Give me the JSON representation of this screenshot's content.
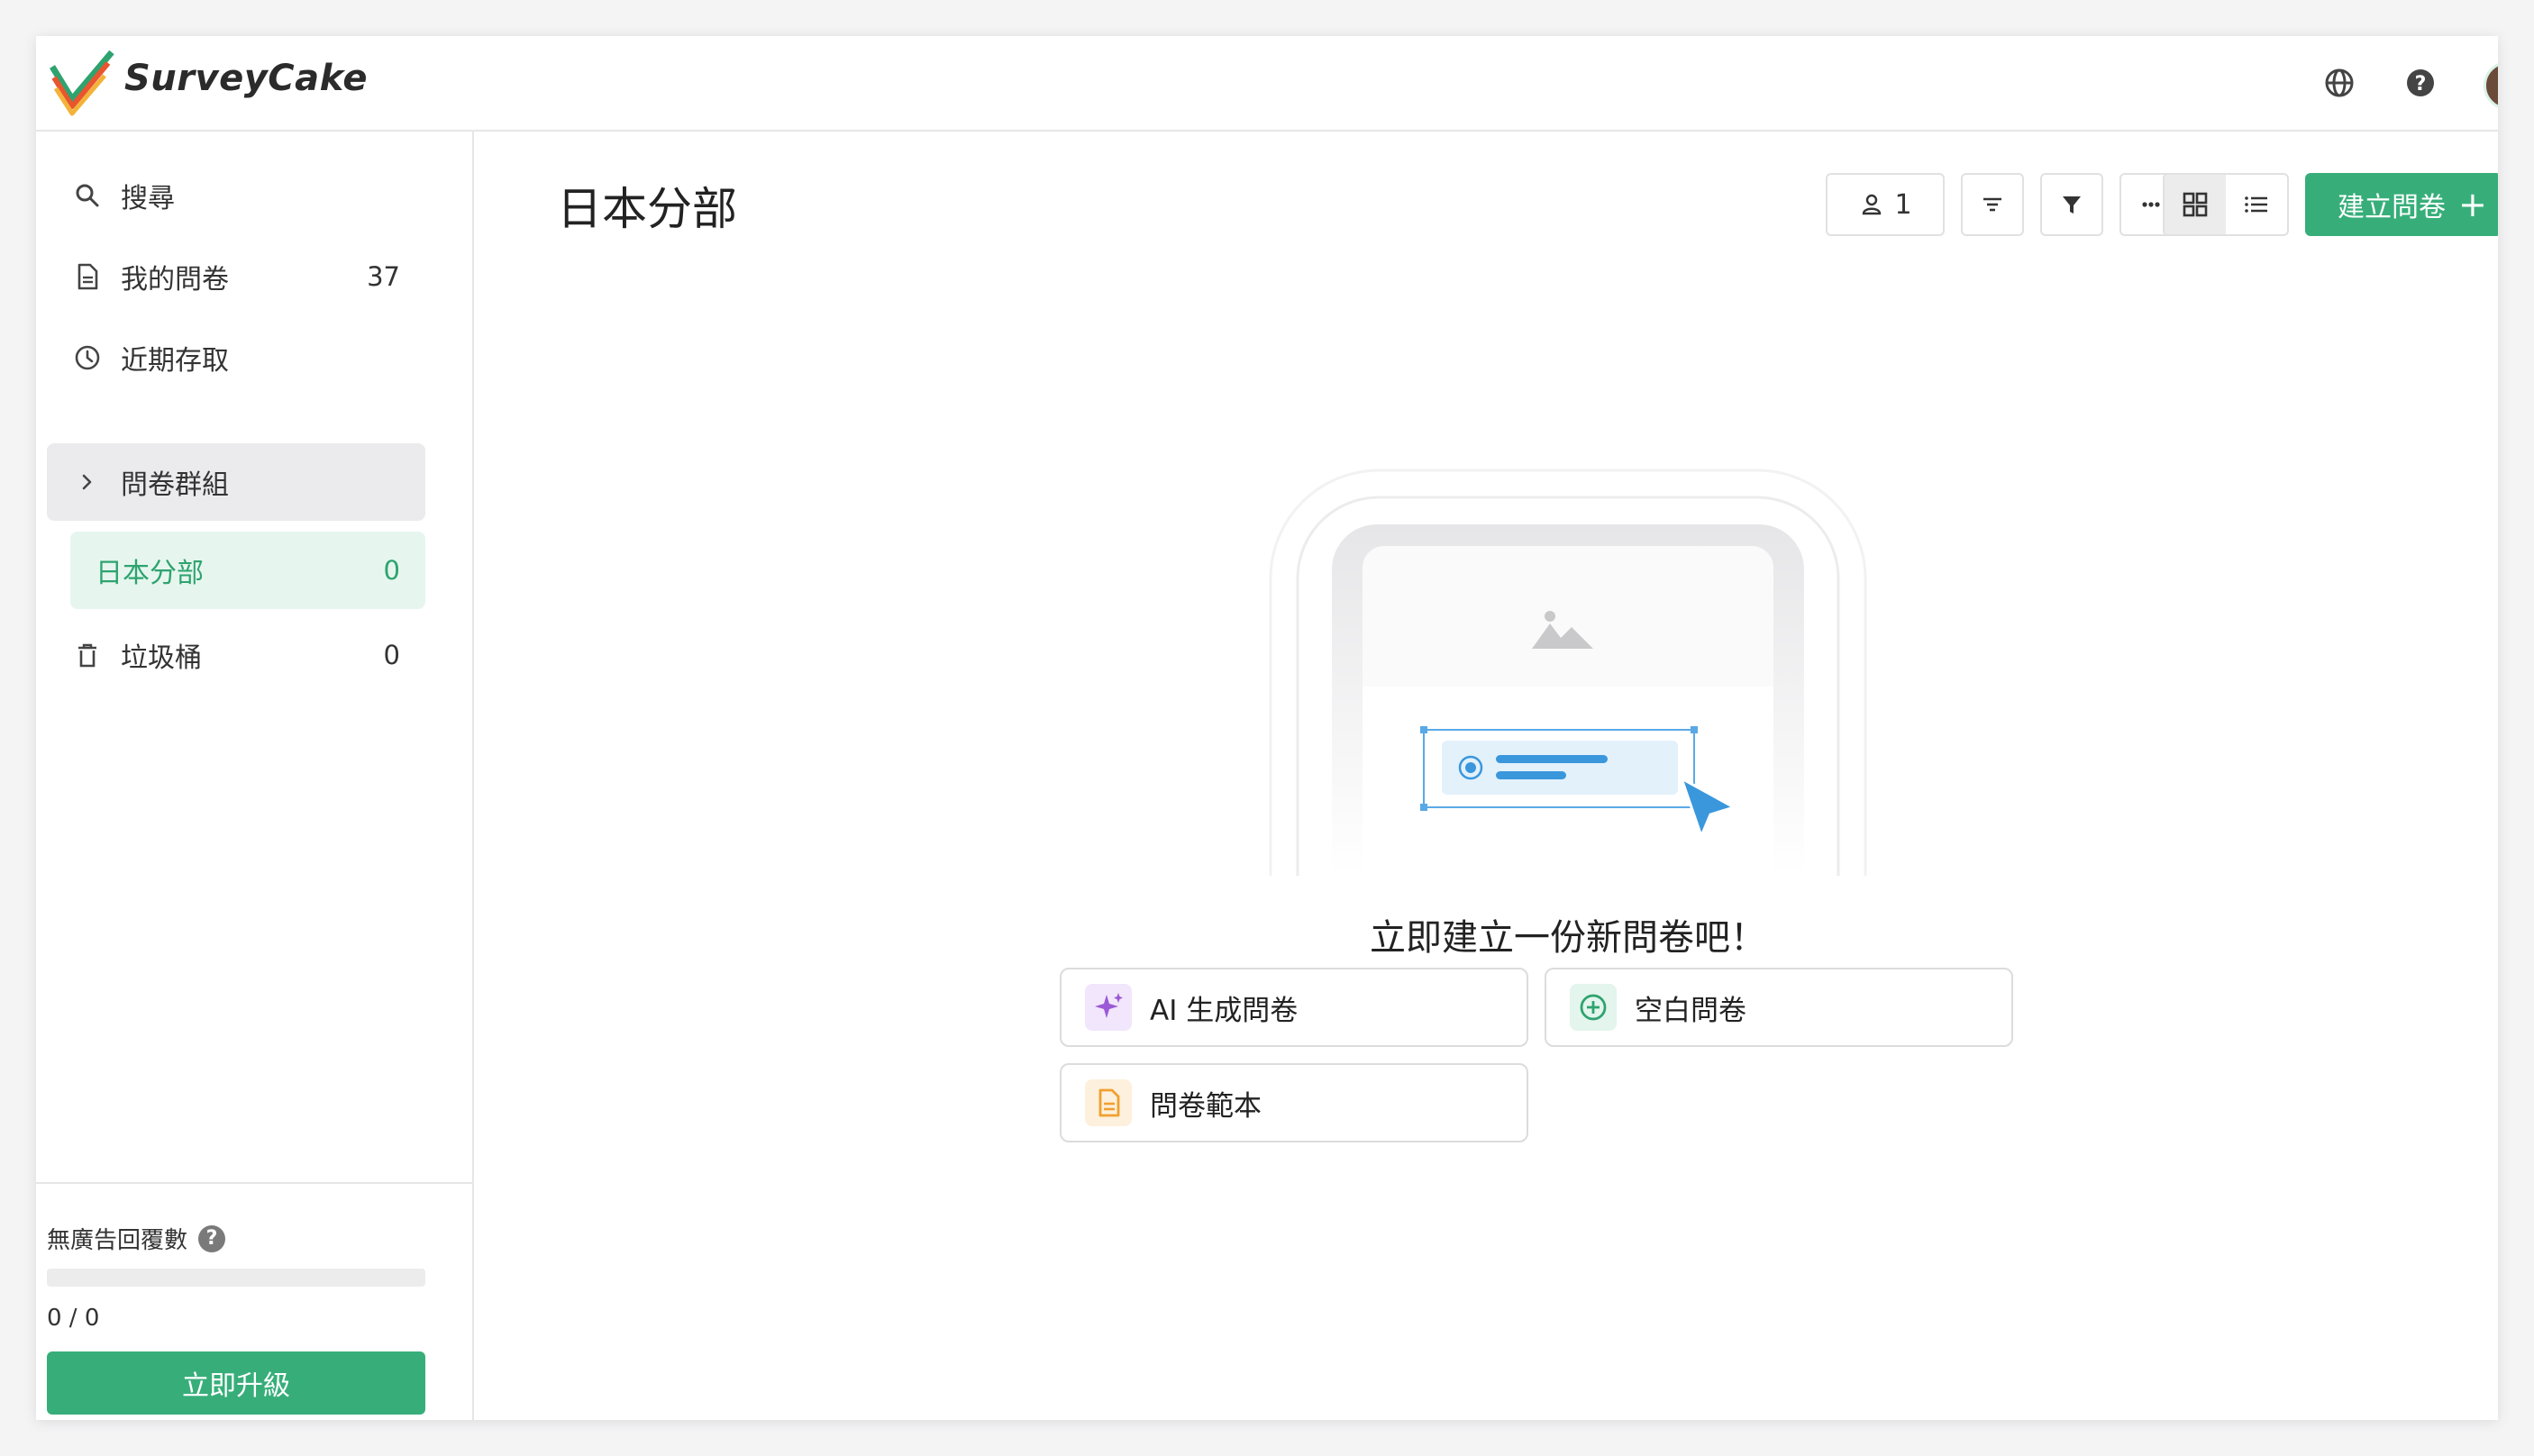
{
  "app": {
    "brand": "SurveyCake"
  },
  "sidebar": {
    "items": [
      {
        "label": "搜尋",
        "icon": "search-icon"
      },
      {
        "label": "我的問卷",
        "count": "37",
        "icon": "document-icon"
      },
      {
        "label": "近期存取",
        "icon": "clock-icon"
      },
      {
        "label": "問卷群組",
        "icon": "chevron-right-icon"
      },
      {
        "label": "日本分部",
        "count": "0"
      },
      {
        "label": "垃圾桶",
        "count": "0",
        "icon": "trash-icon"
      }
    ],
    "quota": {
      "title": "無廣告回覆數",
      "value": "0 / 0",
      "fraction": 0
    },
    "upgrade_label": "立即升級"
  },
  "main": {
    "title": "日本分部",
    "toolbar": {
      "members_count": "1",
      "create_label": "建立問卷"
    },
    "empty": {
      "title": "立即建立一份新問卷吧！",
      "options": [
        {
          "label": "AI 生成問卷",
          "icon": "sparkle-icon"
        },
        {
          "label": "空白問卷",
          "icon": "plus-circle-icon"
        },
        {
          "label": "問卷範本",
          "icon": "template-icon"
        }
      ]
    }
  },
  "colors": {
    "accent": "#37ae79",
    "active_bg": "#e6f6ee",
    "ai_purple": "#9b59d6",
    "template_orange": "#f0a030"
  }
}
